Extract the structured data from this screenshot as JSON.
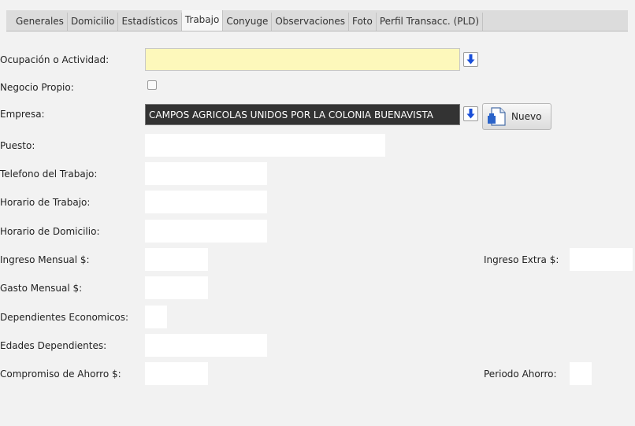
{
  "tabs": [
    "Generales",
    "Domicilio",
    "Estadísticos",
    "Trabajo",
    "Conyuge",
    "Observaciones",
    "Foto",
    "Perfil Transacc. (PLD)"
  ],
  "active_tab": "Trabajo",
  "form": {
    "ocupacion_label": "Ocupación o Actividad:",
    "ocupacion_value": "",
    "negocio_label": "Negocio Propio:",
    "negocio_checked": false,
    "empresa_label": "Empresa:",
    "empresa_value": "CAMPOS AGRICOLAS UNIDOS POR LA COLONIA BUENAVISTA",
    "nuevo_label": "Nuevo",
    "puesto_label": "Puesto:",
    "puesto_value": "",
    "telefono_label": "Telefono del Trabajo:",
    "telefono_value": "",
    "horario_trabajo_label": "Horario de Trabajo:",
    "horario_trabajo_value": "",
    "horario_domicilio_label": "Horario de Domicilio:",
    "horario_domicilio_value": "",
    "ingreso_mensual_label": "Ingreso Mensual $:",
    "ingreso_mensual_value": "",
    "ingreso_extra_label": "Ingreso Extra $:",
    "ingreso_extra_value": "",
    "gasto_mensual_label": "Gasto Mensual $:",
    "gasto_mensual_value": "",
    "dependientes_label": "Dependientes Economicos:",
    "dependientes_value": "",
    "edades_label": "Edades Dependientes:",
    "edades_value": "",
    "compromiso_label": "Compromiso de Ahorro $:",
    "compromiso_value": "",
    "periodo_label": "Periodo Ahorro:",
    "periodo_value": ""
  },
  "icons": {
    "arrow_color": "#1a4fd8",
    "arrow": "arrow-down-icon",
    "new_document": "new-document-icon"
  }
}
